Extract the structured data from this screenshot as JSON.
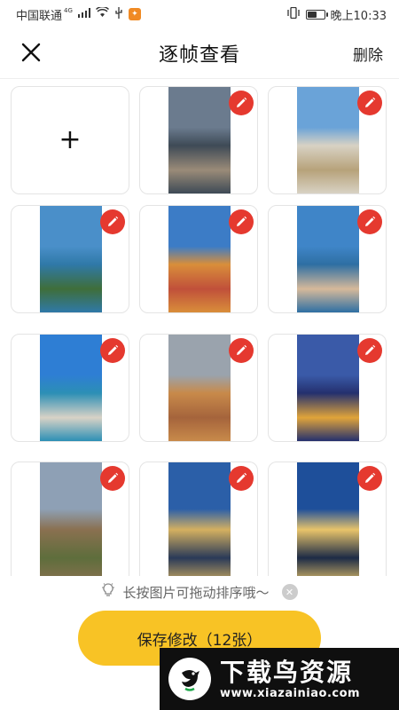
{
  "status_bar": {
    "carrier": "中国联通",
    "network": "4G",
    "time": "晚上10:33",
    "battery_level": 0.6
  },
  "nav": {
    "title": "逐帧查看",
    "delete_label": "删除",
    "close_icon": "close-icon"
  },
  "grid": {
    "add_icon": "plus-icon",
    "edit_icon": "pencil-icon",
    "photos": [
      {
        "name": "city-skyline-clouds",
        "sky": "#6b7b8e",
        "ground": "#9a8b78",
        "accent": "#3e4a56"
      },
      {
        "name": "palace-garden",
        "sky": "#6aa3d8",
        "ground": "#b7a27a",
        "accent": "#d8d2c4"
      },
      {
        "name": "coastal-islands",
        "sky": "#4a8fc9",
        "ground": "#3f6e3a",
        "accent": "#2f79a8"
      },
      {
        "name": "waterfront-sunset",
        "sky": "#3c7cc6",
        "ground": "#c0503a",
        "accent": "#d98e3a"
      },
      {
        "name": "lakeside-church-town",
        "sky": "#3f85c8",
        "ground": "#d6b99a",
        "accent": "#2e6fa3"
      },
      {
        "name": "cliffside-village",
        "sky": "#2e7ed4",
        "ground": "#d8d2c6",
        "accent": "#2c8fb5"
      },
      {
        "name": "cathedral-rooftops",
        "sky": "#9aa3ad",
        "ground": "#a5643c",
        "accent": "#c88a4a"
      },
      {
        "name": "golden-temple-reflection",
        "sky": "#3a5aa8",
        "ground": "#e0a43a",
        "accent": "#24306e"
      },
      {
        "name": "great-wall-hills",
        "sky": "#8ea0b5",
        "ground": "#5e6e3c",
        "accent": "#8a7050"
      },
      {
        "name": "skyscrapers-dusk",
        "sky": "#2b5fa8",
        "ground": "#2a3a58",
        "accent": "#d4b060"
      },
      {
        "name": "city-towers-night",
        "sky": "#1e4f9a",
        "ground": "#1d2b46",
        "accent": "#e8c46a"
      }
    ]
  },
  "hint": {
    "text": "长按图片可拖动排序哦～",
    "icon": "lightbulb-icon",
    "close_icon": "close-circle-icon"
  },
  "save_button": {
    "label": "保存修改（12张）",
    "color": "#f8c325"
  },
  "watermark": {
    "title": "下载鸟资源",
    "url": "www.xiazainiao.com"
  },
  "colors": {
    "edit_badge": "#e5392f",
    "accent": "#f8c325"
  }
}
